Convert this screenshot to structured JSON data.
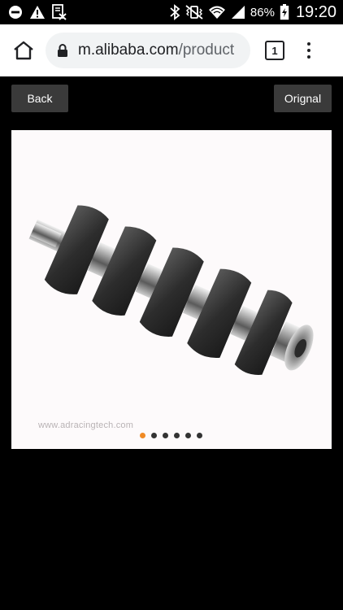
{
  "status_bar": {
    "battery": "86%",
    "time": "19:20",
    "icons": [
      "do-not-disturb-icon",
      "warning-icon",
      "notification-doc-icon",
      "bluetooth-icon",
      "vibrate-icon",
      "wifi-icon",
      "signal-icon",
      "battery-icon"
    ]
  },
  "browser": {
    "url_host": "m.alibaba.com",
    "url_path": "/product",
    "tab_count": "1"
  },
  "viewer": {
    "back_label": "Back",
    "original_label": "Orignal",
    "watermark": "www.adracingtech.com",
    "carousel_total": 6,
    "carousel_active_index": 0
  },
  "colors": {
    "accent_dot": "#f08a24",
    "button_bg": "#3a3a3a"
  }
}
